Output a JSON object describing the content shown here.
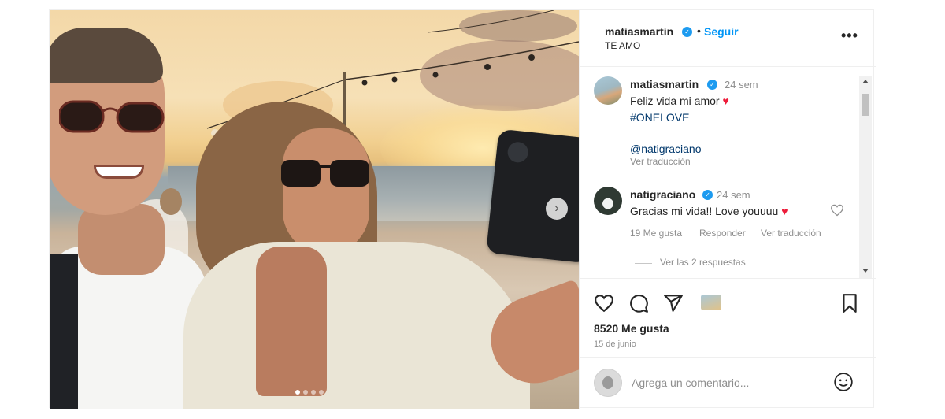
{
  "post": {
    "username": "matiasmartin",
    "follow_label": "Seguir",
    "separator": "•",
    "subtitle": "TE AMO",
    "more_label": "•••",
    "carousel_next": "›",
    "carousel_total": 4,
    "carousel_active": 1
  },
  "comments": [
    {
      "username": "matiasmartin",
      "time": "24 sem",
      "line1": "Feliz vida mi amor",
      "emoji": "♥",
      "line2": "#ONELOVE",
      "mention": "@natigraciano",
      "translate": "Ver traducción"
    },
    {
      "username": "natigraciano",
      "time": "24 sem",
      "text": "Gracias mi vida!! Love youuuu",
      "emoji": "♥",
      "likes": "19 Me gusta",
      "reply": "Responder",
      "translate": "Ver traducción",
      "replies": "Ver las 2 respuestas"
    }
  ],
  "actions": {
    "likes": "8520 Me gusta",
    "date": "15 de junio"
  },
  "add_comment": {
    "placeholder": "Agrega un comentario..."
  },
  "colors": {
    "verified": "#1d9bf0",
    "follow": "#0095f6",
    "heart": "#ed1c3a",
    "muted": "#8e8e8e"
  }
}
